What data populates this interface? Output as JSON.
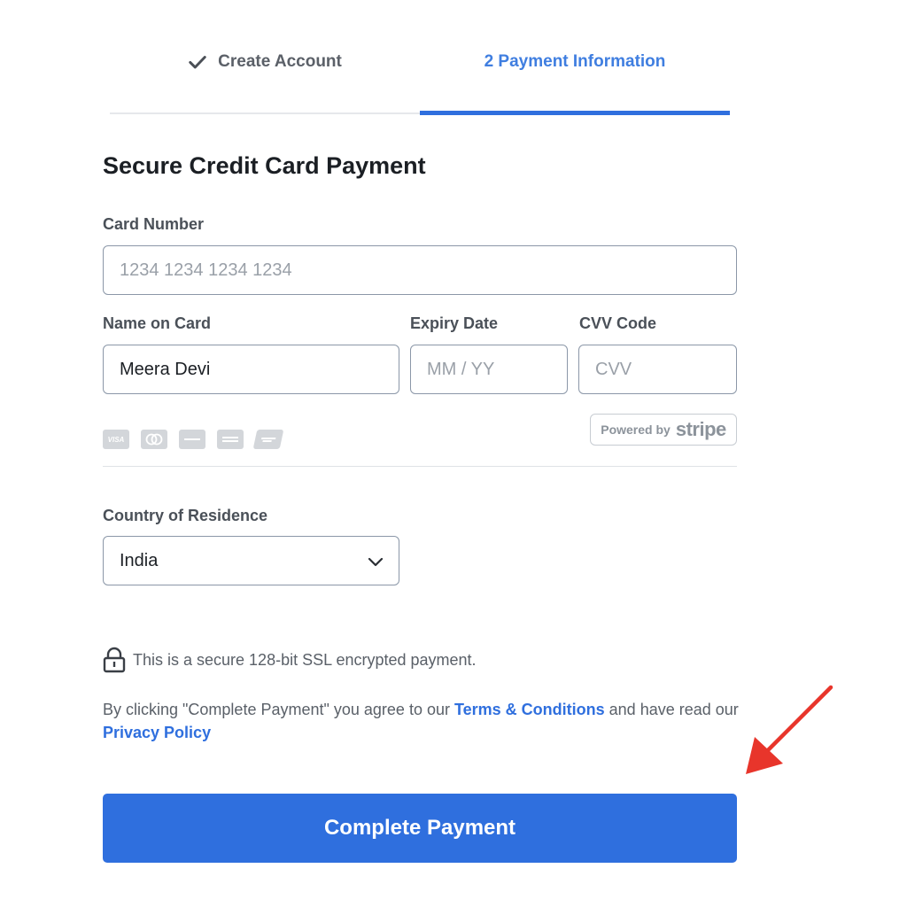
{
  "steps": [
    {
      "label": "Create Account",
      "state": "completed"
    },
    {
      "label": "2 Payment Information",
      "state": "active"
    }
  ],
  "form": {
    "heading": "Secure Credit Card Payment",
    "card_number": {
      "label": "Card Number",
      "placeholder": "1234 1234 1234 1234",
      "value": ""
    },
    "name_on_card": {
      "label": "Name on Card",
      "value": "Meera Devi"
    },
    "expiry": {
      "label": "Expiry Date",
      "placeholder": "MM / YY",
      "value": ""
    },
    "cvv": {
      "label": "CVV Code",
      "placeholder": "CVV",
      "value": ""
    },
    "card_brands": [
      "VISA",
      "mastercard-icon",
      "discover-icon",
      "amex-icon",
      "unionpay-icon"
    ],
    "powered_by": {
      "prefix": "Powered by",
      "brand": "stripe"
    },
    "country": {
      "label": "Country of Residence",
      "value": "India"
    }
  },
  "security_note": "This is a secure 128-bit SSL encrypted payment.",
  "agreement": {
    "before": "By clicking \"Complete Payment\" you agree to our ",
    "terms_link": "Terms & Conditions",
    "middle": " and have read our ",
    "privacy_link": "Privacy Policy"
  },
  "submit_label": "Complete Payment",
  "colors": {
    "accent": "#2f6fde",
    "annotation_arrow": "#e8352b"
  }
}
